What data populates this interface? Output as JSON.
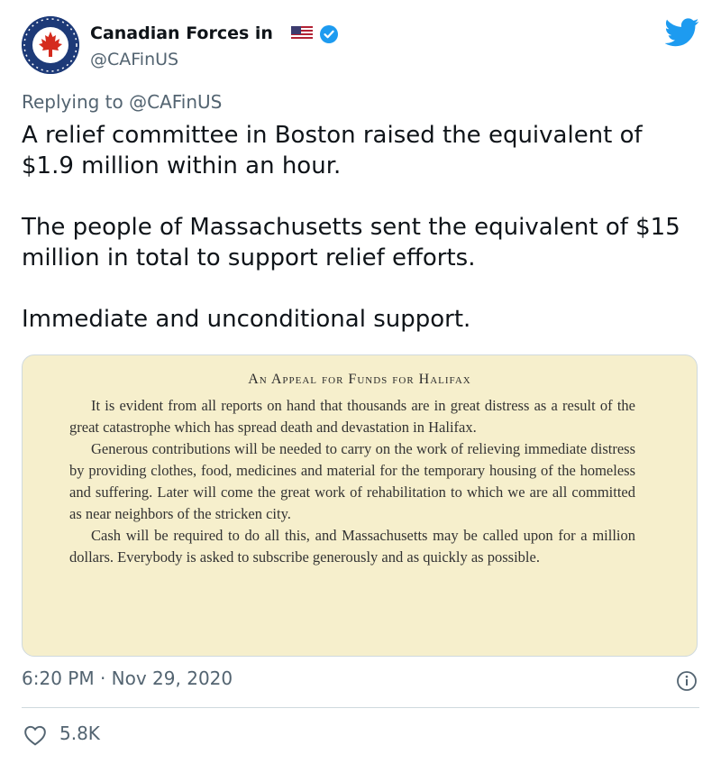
{
  "author": {
    "display_name": "Canadian Forces in",
    "handle": "@CAFinUS",
    "verified": true,
    "flag_icon": "us-flag-icon"
  },
  "reply_to": "Replying to @CAFinUS",
  "tweet": {
    "paragraphs": [
      "A relief committee in Boston raised the equivalent of $1.9 million within an hour.",
      "The people of Massachusetts sent the equivalent of $15 million in total to support relief efforts.",
      "Immediate and unconditional support."
    ]
  },
  "media": {
    "title": "An Appeal for Funds for Halifax",
    "paragraphs": [
      "It is evident from all reports on hand that thousands are in great distress as a result of the great catastrophe which has spread death and devastation in Halifax.",
      "Generous contributions will be needed to carry on the work of relieving immediate distress by providing clothes, food, medicines and material for the temporary housing of the homeless and suffering. Later will come the great work of rehabilitation to which we are all committed as near neighbors of the stricken city.",
      "Cash will be required to do all this, and Massachusetts may be called upon for a million dollars. Everybody is asked to subscribe generously and as quickly as possible."
    ]
  },
  "timestamp": "6:20 PM · Nov 29, 2020",
  "likes": "5.8K",
  "colors": {
    "twitter_blue": "#1d9bf0",
    "text_primary": "#0f1419",
    "text_secondary": "#536471",
    "paper": "#f6efcc",
    "avatar_navy": "#1d3a78",
    "maple_red": "#d52b1e"
  }
}
